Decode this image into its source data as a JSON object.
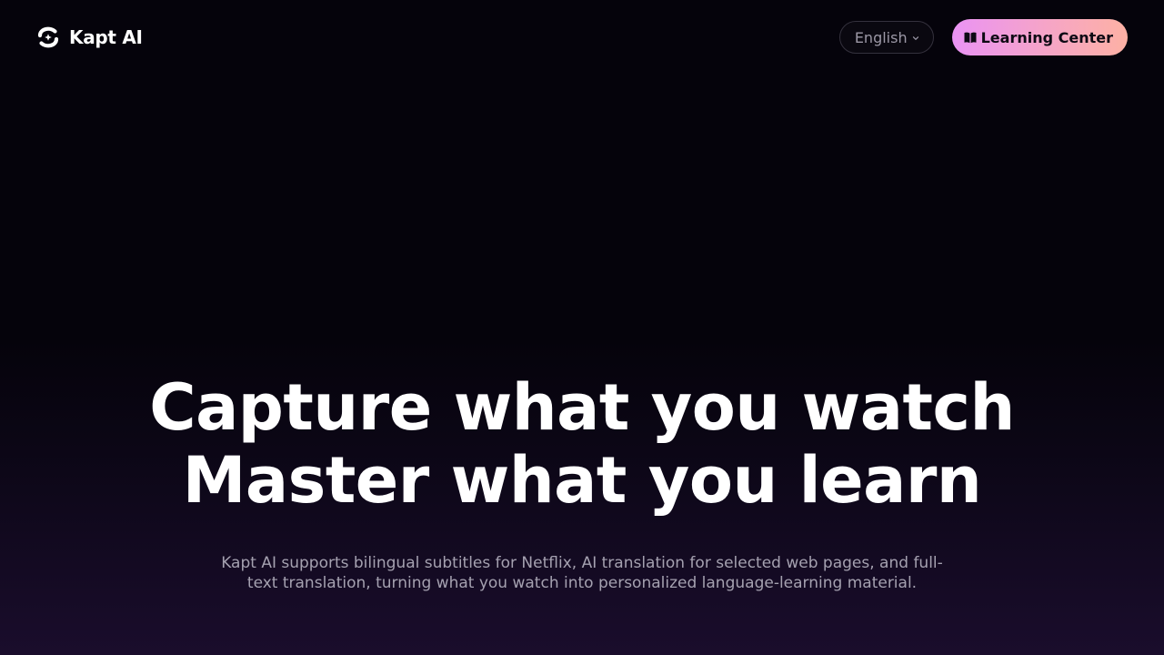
{
  "header": {
    "brand_name": "Kapt AI",
    "logo_icon": "kapt-logo-icon",
    "language_label": "English",
    "language_icon": "chevron-down-icon",
    "learning_center_label": "Learning Center",
    "learning_center_icon": "book-icon"
  },
  "hero": {
    "title_line_1": "Capture what you watch",
    "title_line_2": "Master what you learn",
    "description": "Kapt AI supports bilingual subtitles for Netflix, AI translation for selected web pages, and full-text translation, turning what you watch into personalized language-learning material."
  },
  "colors": {
    "background": "#05030b",
    "background_bottom": "#1a0d2c",
    "text_primary": "#ffffff",
    "text_muted": "#a5a1b0",
    "button_gradient_start": "#ea93f4",
    "button_gradient_end": "#fdb1a4"
  }
}
